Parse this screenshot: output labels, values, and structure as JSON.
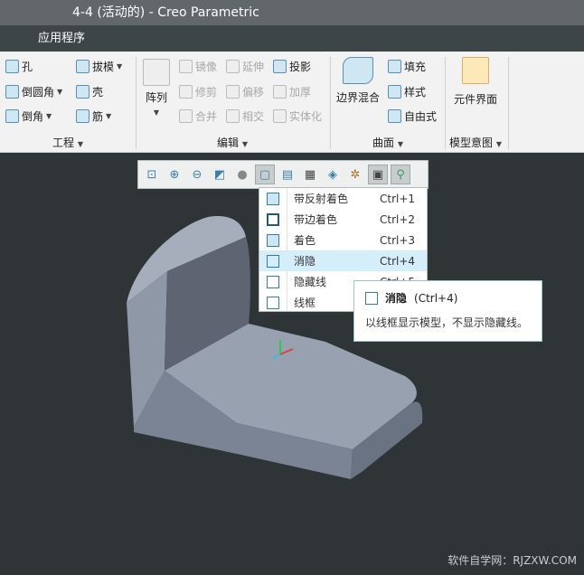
{
  "window": {
    "title": "4-4 (活动的) - Creo Parametric"
  },
  "menu": {
    "label": "应用程序"
  },
  "ribbon": {
    "groups": [
      {
        "label": "工程",
        "items": [
          "孔",
          "倒圆角",
          "倒角",
          "拔模",
          "壳",
          "筋"
        ]
      },
      {
        "label": "编辑",
        "items": [
          "阵列",
          "镜像",
          "修剪",
          "合并",
          "延伸",
          "偏移",
          "相交",
          "投影",
          "加厚",
          "实体化"
        ]
      },
      {
        "label": "曲面",
        "items": [
          "边界混合",
          "填充",
          "样式",
          "自由式"
        ]
      },
      {
        "label": "模型意图",
        "items": [
          "元件界面"
        ]
      }
    ]
  },
  "view_toolbar": {
    "icons": [
      "zoom-fit-icon",
      "zoom-in-icon",
      "zoom-out-icon",
      "repaint-icon",
      "appearance-icon",
      "display-style-icon",
      "saved-views-icon",
      "view-manager-icon",
      "perspective-icon",
      "datum-display-icon",
      "annotation-display-icon",
      "spin-center-icon"
    ]
  },
  "display_menu": {
    "items": [
      {
        "label": "带反射着色",
        "shortcut": "Ctrl+1"
      },
      {
        "label": "带边着色",
        "shortcut": "Ctrl+2"
      },
      {
        "label": "着色",
        "shortcut": "Ctrl+3"
      },
      {
        "label": "消隐",
        "shortcut": "Ctrl+4"
      },
      {
        "label": "隐藏线",
        "shortcut": "Ctrl+5"
      },
      {
        "label": "线框",
        "shortcut": ""
      }
    ],
    "highlighted": "消隐"
  },
  "tooltip": {
    "title": "消隐",
    "shortcut": "(Ctrl+4)",
    "description": "以线框显示模型，不显示隐藏线。"
  },
  "watermark": "软件自学网：RJZXW.COM"
}
